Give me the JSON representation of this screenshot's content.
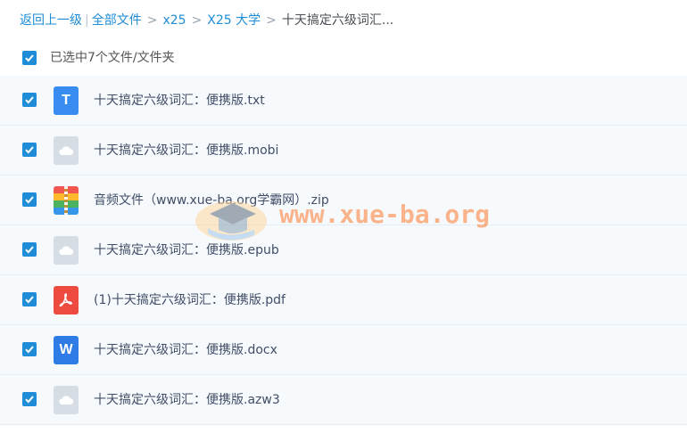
{
  "breadcrumb": {
    "back": "返回上一级",
    "all_files": "全部文件",
    "path": [
      "x25",
      "X25 大学"
    ],
    "current": "十天搞定六级词汇...",
    "pipe": "|",
    "sep": ">"
  },
  "selection": {
    "summary": "已选中7个文件/文件夹"
  },
  "files": [
    {
      "name": "十天搞定六级词汇：便携版.txt",
      "icon": "txt-file-icon",
      "glyph": "T"
    },
    {
      "name": "十天搞定六级词汇：便携版.mobi",
      "icon": "generic-file-icon"
    },
    {
      "name": "音频文件（www.xue-ba.org学霸网）.zip",
      "icon": "zip-file-icon"
    },
    {
      "name": "十天搞定六级词汇：便携版.epub",
      "icon": "generic-file-icon"
    },
    {
      "name": "(1)十天搞定六级词汇：便携版.pdf",
      "icon": "pdf-file-icon"
    },
    {
      "name": "十天搞定六级词汇：便携版.docx",
      "icon": "word-file-icon",
      "glyph": "W"
    },
    {
      "name": "十天搞定六级词汇：便携版.azw3",
      "icon": "generic-file-icon"
    }
  ],
  "watermark": {
    "text": "www.xue-ba.org"
  },
  "colors": {
    "accent": "#1e8cd6",
    "row_bg": "#f6fafd"
  }
}
